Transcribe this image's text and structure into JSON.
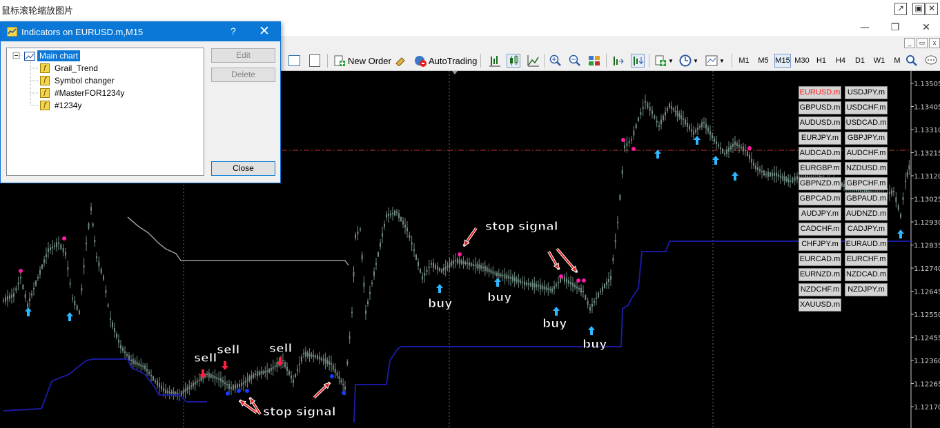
{
  "viewer": {
    "title": "鼠标滚轮缩放图片"
  },
  "toolbar": {
    "new_order": "New Order",
    "autotrading": "AutoTrading",
    "timeframes": [
      "M1",
      "M5",
      "M15",
      "M30",
      "H1",
      "H4",
      "D1",
      "W1",
      "M"
    ],
    "selected_timeframe": "M15"
  },
  "dialog": {
    "title": "Indicators on EURUSD.m,M15",
    "help": "?",
    "close_x": "✕",
    "root_label": "Main chart",
    "indicators": [
      "Grail_Trend",
      "Symbol changer",
      "#MasterFOR1234y",
      "#1234y"
    ],
    "edit_label": "Edit",
    "delete_label": "Delete",
    "close_label": "Close"
  },
  "symbols": {
    "left": [
      "EURUSD.m",
      "GBPUSD.m",
      "AUDUSD.m",
      "EURJPY.m",
      "AUDCAD.m",
      "EURGBP.m",
      "GBPNZD.m",
      "GBPCAD.m",
      "AUDJPY.m",
      "CADCHF.m",
      "CHFJPY.m",
      "EURCAD.m",
      "EURNZD.m",
      "NZDCHF.m",
      "XAUUSD.m"
    ],
    "right": [
      "USDJPY.m",
      "USDCHF.m",
      "USDCAD.m",
      "GBPJPY.m",
      "AUDCHF.m",
      "NZDUSD.m",
      "GBPCHF.m",
      "GBPAUD.m",
      "AUDNZD.m",
      "CADJPY.m",
      "EURAUD.m",
      "EURCHF.m",
      "NZDCAD.m",
      "NZDJPY.m"
    ],
    "active": "EURUSD.m",
    "active_color": "#ff1a1a"
  },
  "chart": {
    "price_labels": [
      "1.13505",
      "1.13405",
      "1.13310",
      "1.13215",
      "1.13120",
      "1.13025",
      "1.12930",
      "1.12835",
      "1.12740",
      "1.12645",
      "1.12550",
      "1.12455",
      "1.12360",
      "1.12265",
      "1.12170"
    ],
    "annotations": {
      "sell_1": "sell",
      "sell_2": "sell",
      "sell_3": "sell",
      "stop_1": "stop signal",
      "stop_2": "stop signal",
      "buy_1": "buy",
      "buy_2": "buy",
      "buy_3": "buy",
      "buy_4": "buy"
    },
    "colors": {
      "background": "#000000",
      "candles": "#6f8a80",
      "trend_line": "#1a1aa0",
      "stop_line": "#9a9a9a",
      "buy_arrow": "#2fb7ff",
      "sell_arrow": "#ff2040",
      "dots_magenta": "#ff1aa5",
      "dots_blue": "#1a3cff",
      "level_line": "#c0362c"
    }
  }
}
